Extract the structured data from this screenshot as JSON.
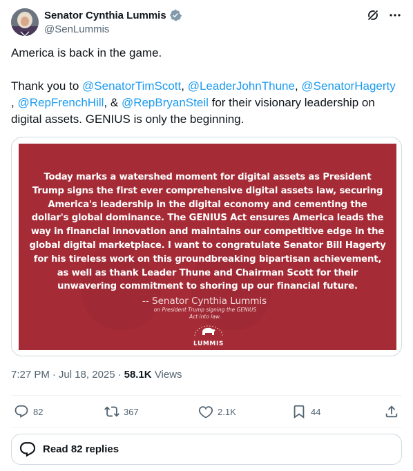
{
  "author": {
    "display_name": "Senator Cynthia Lummis",
    "handle": "@SenLummis"
  },
  "header_icons": [
    "grok-icon",
    "more-icon"
  ],
  "tweet": {
    "line1": "America is back in the game.",
    "thanks_prefix": "Thank you to ",
    "mentions": [
      "@SenatorTimScott",
      "@LeaderJohnThune",
      "@SenatorHagerty",
      "@RepFrenchHill",
      "@RepBryanSteil"
    ],
    "sep_comma": ", ",
    "leading_comma": ", ",
    "amp": ", & ",
    "thanks_suffix": " for their visionary leadership on digital assets. GENIUS is only the beginning."
  },
  "media": {
    "statement": "Today marks a watershed moment for digital assets as President Trump signs the first ever comprehensive digital assets law, securing America's leadership in the digital economy and cementing the dollar's global dominance. The GENIUS Act ensures America leads the way in financial innovation and maintains our competitive edge in the global digital marketplace. I want to congratulate Senator Bill Hagerty for his tireless work on this groundbreaking bipartisan achievement, as well as thank Leader Thune and Chairman Scott for their unwavering commitment to shoring up our financial future.",
    "attribution": "-- Senator Cynthia Lummis",
    "sub_caption": "on President Trump signing the GENIUS Act into law.",
    "logo_text": "LUMMIS",
    "background_color": "#a52b36"
  },
  "meta": {
    "time": "7:27 PM",
    "date": "Jul 18, 2025",
    "dot": "·",
    "views_count": "58.1K",
    "views_label": "Views"
  },
  "actions": {
    "replies": "82",
    "reposts": "367",
    "likes": "2.1K",
    "bookmarks": "44"
  },
  "read_replies_label": "Read 82 replies",
  "colors": {
    "accent": "#1d9bf0",
    "secondary_text": "#536471",
    "statement_bg": "#a52b36"
  }
}
